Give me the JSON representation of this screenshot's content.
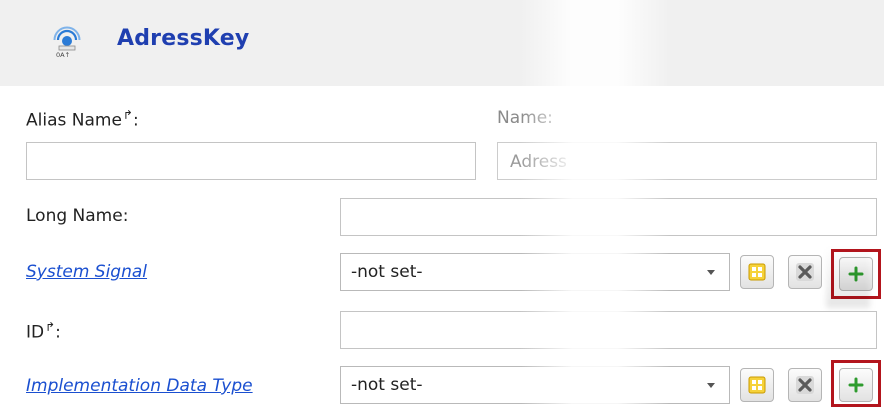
{
  "header": {
    "title": "AdressKey",
    "icon": "network-address-icon"
  },
  "fields": {
    "alias_name": {
      "label": "Alias Name",
      "value": ""
    },
    "name": {
      "label": "Name:",
      "value": "Adress"
    },
    "long_name": {
      "label": "Long Name:",
      "value": ""
    },
    "system_signal": {
      "label": "System Signal",
      "value": "-not set-"
    },
    "id": {
      "label": "ID",
      "value": ""
    },
    "implementation_data_type": {
      "label": "Implementation Data Type",
      "value": "-not set-"
    }
  },
  "colors": {
    "title": "#1f3fb0",
    "link": "#1a4fd0",
    "highlight": "#b3151d",
    "add_plus": "#2e9b2e",
    "select_icon": "#e2b000"
  }
}
